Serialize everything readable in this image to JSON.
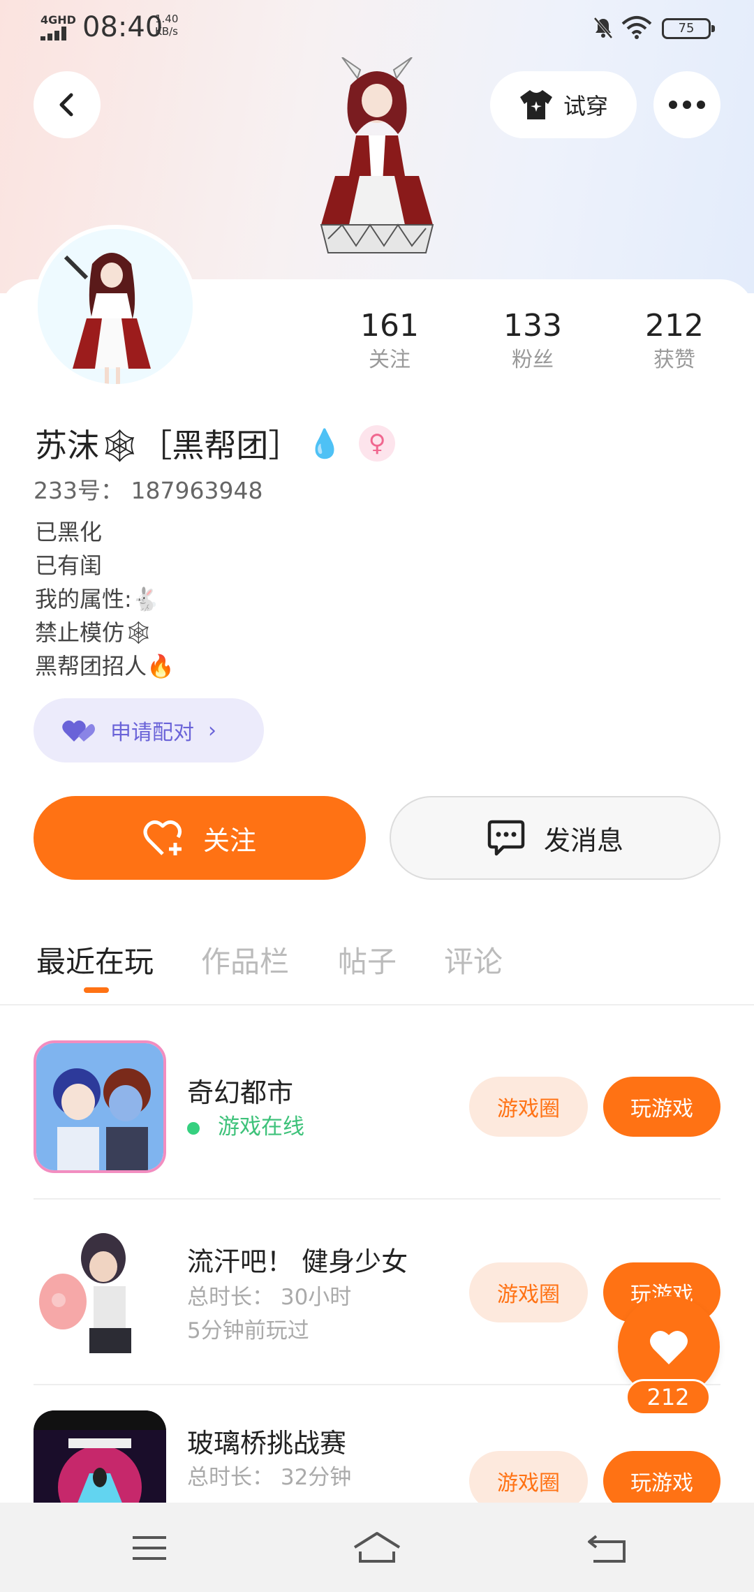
{
  "status_bar": {
    "network": "4GHD",
    "time": "08:40",
    "speed_value": "1.40",
    "speed_unit": "KB/s",
    "battery": "75"
  },
  "header": {
    "tryon_label": "试穿"
  },
  "profile": {
    "stats": [
      {
        "value": "161",
        "label": "关注"
      },
      {
        "value": "133",
        "label": "粉丝"
      },
      {
        "value": "212",
        "label": "获赞"
      }
    ],
    "name": "苏沫🕸［黑帮团］",
    "name_emoji": "💧",
    "gender_symbol": "♀",
    "uid": "233号： 187963948",
    "bio": [
      "已黑化",
      "已有闺",
      "我的属性:🐇",
      "禁止模仿🕸",
      "黑帮团招人🔥"
    ],
    "match_label": "申请配对",
    "follow_label": "关注",
    "message_label": "发消息"
  },
  "tabs": [
    {
      "label": "最近在玩",
      "active": true
    },
    {
      "label": "作品栏",
      "active": false
    },
    {
      "label": "帖子",
      "active": false
    },
    {
      "label": "评论",
      "active": false
    }
  ],
  "games": [
    {
      "title": "奇幻都市",
      "status": "游戏在线",
      "circle_label": "游戏圈",
      "play_label": "玩游戏"
    },
    {
      "title": "流汗吧！ 健身少女",
      "duration": "总时长： 30小时",
      "last_played": "5分钟前玩过",
      "circle_label": "游戏圈",
      "play_label": "玩游戏"
    },
    {
      "title": "玻璃桥挑战赛",
      "duration": "总时长： 32分钟",
      "circle_label": "游戏圈",
      "play_label": "玩游戏"
    }
  ],
  "like_fab": {
    "count": "212"
  },
  "colors": {
    "accent": "#ff7214",
    "match_purple": "#6a63d8",
    "online_green": "#3ec27a"
  }
}
